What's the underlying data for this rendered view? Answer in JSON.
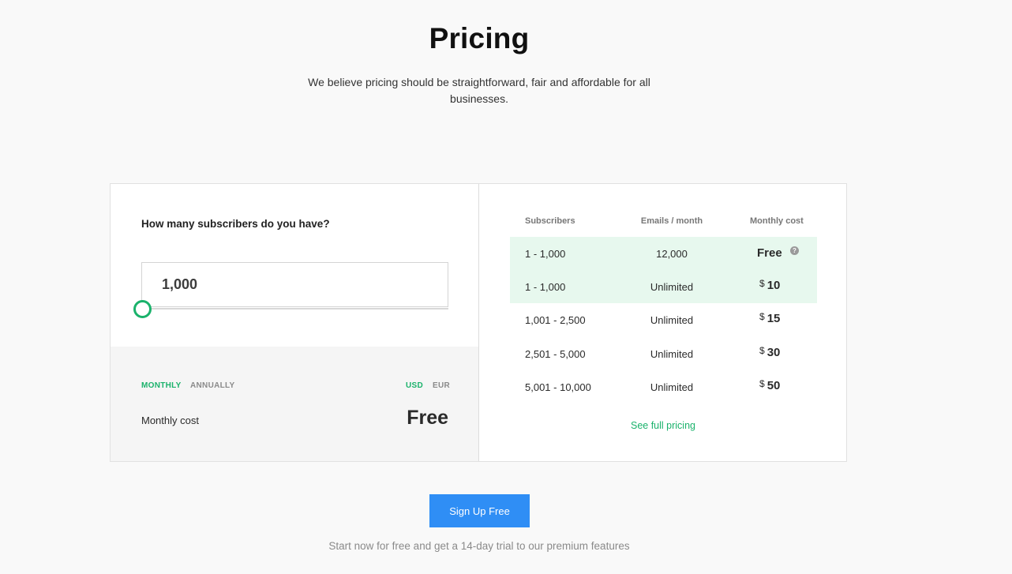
{
  "header": {
    "title": "Pricing",
    "subtitle": "We believe pricing should be straightforward, fair and affordable for all businesses."
  },
  "calculator": {
    "question": "How many subscribers do you have?",
    "subscribers_value": "1,000",
    "slider_position": 0,
    "billing": {
      "monthly": "MONTHLY",
      "annually": "ANNUALLY",
      "selected": "MONTHLY"
    },
    "currency": {
      "usd": "USD",
      "eur": "EUR",
      "selected": "USD"
    },
    "cost_label": "Monthly cost",
    "cost_value": "Free"
  },
  "table": {
    "headers": {
      "subscribers": "Subscribers",
      "emails": "Emails / month",
      "cost": "Monthly cost"
    },
    "rows": [
      {
        "subscribers": "1 - 1,000",
        "emails": "12,000",
        "cost": "Free",
        "highlighted": true
      },
      {
        "subscribers": "1 - 1,000",
        "emails": "Unlimited",
        "currency": "$",
        "cost": "10",
        "highlighted": true
      },
      {
        "subscribers": "1,001 - 2,500",
        "emails": "Unlimited",
        "currency": "$",
        "cost": "15",
        "highlighted": false
      },
      {
        "subscribers": "2,501 - 5,000",
        "emails": "Unlimited",
        "currency": "$",
        "cost": "30",
        "highlighted": false
      },
      {
        "subscribers": "5,001 - 10,000",
        "emails": "Unlimited",
        "currency": "$",
        "cost": "50",
        "highlighted": false
      }
    ],
    "help_glyph": "?",
    "full_pricing_link": "See full pricing"
  },
  "cta": {
    "button": "Sign Up Free",
    "footnote": "Start now for free and get a 14-day trial to our premium features"
  },
  "colors": {
    "accent": "#1ab26b",
    "button": "#2f8ef5",
    "highlight_row": "#e7f8ee"
  }
}
